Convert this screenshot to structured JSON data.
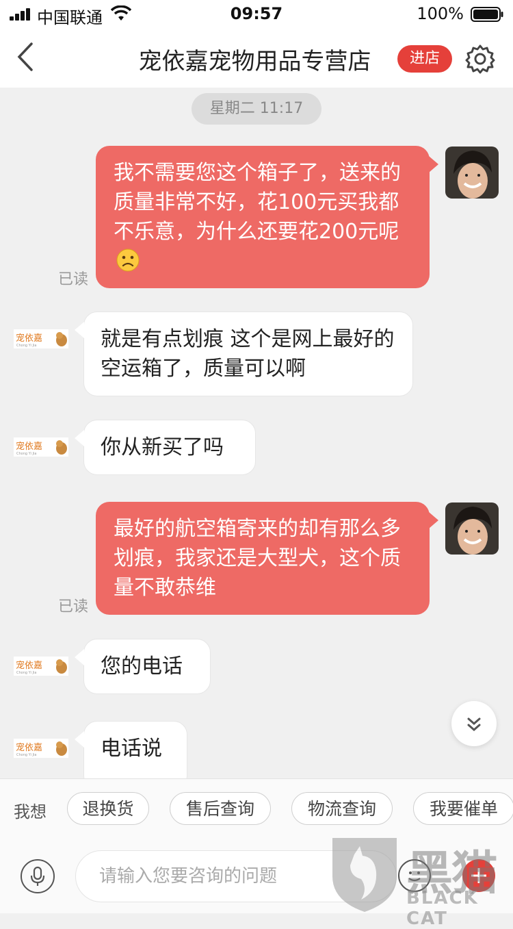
{
  "status_bar": {
    "carrier": "中国联通",
    "time": "09:57",
    "battery": "100%"
  },
  "nav": {
    "title": "宠依嘉宠物用品专营店",
    "store_button": "进店"
  },
  "chat": {
    "timestamp": "星期二 11:17",
    "messages": [
      {
        "from": "me",
        "text": "我不需要您这个箱子了，送来的质量非常不好，花100元买我都不乐意，为什么还要花200元呢",
        "emoji": "slightly-frowning-face",
        "status": "已读"
      },
      {
        "from": "shop",
        "text": "就是有点划痕   这个是网上最好的空运箱了，质量可以啊"
      },
      {
        "from": "shop",
        "text": "你从新买了吗"
      },
      {
        "from": "me",
        "text": "最好的航空箱寄来的却有那么多划痕，我家还是大型犬，这个质量不敢恭维",
        "status": "已读"
      },
      {
        "from": "shop",
        "text": "您的电话"
      },
      {
        "from": "shop",
        "text": "电话说"
      }
    ]
  },
  "quick_bar": {
    "label": "我想",
    "chips": [
      "退换货",
      "售后查询",
      "物流查询",
      "我要催单"
    ]
  },
  "input": {
    "placeholder": "请输入您要咨询的问题"
  },
  "shop_logo_text": "宠依嘉",
  "watermark": {
    "cn": "黑猫",
    "en": "BLACK CAT"
  },
  "colors": {
    "accent": "#e5403a",
    "my_bubble": "#ee6a65",
    "background": "#f0f0f0"
  }
}
